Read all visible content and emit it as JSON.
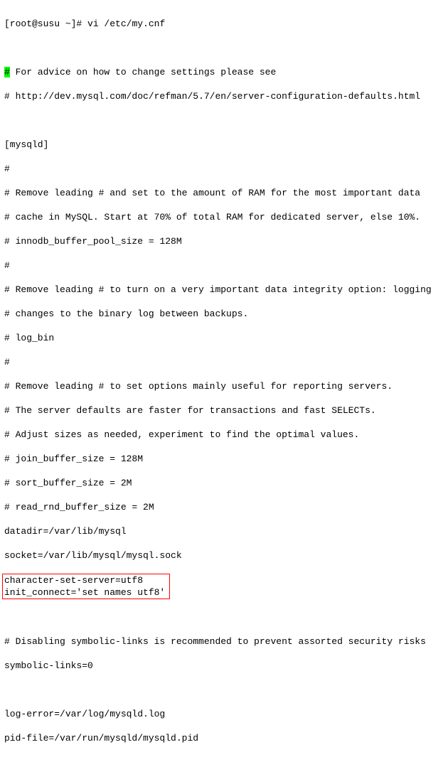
{
  "prompt": "[root@susu ~]# ",
  "command": "vi /etc/my.cnf",
  "lines": {
    "l00_hash": "#",
    "l00_rest": " For advice on how to change settings please see",
    "l01": "# http://dev.mysql.com/doc/refman/5.7/en/server-configuration-defaults.html",
    "l02": "",
    "l03": "[mysqld]",
    "l04": "#",
    "l05": "# Remove leading # and set to the amount of RAM for the most important data",
    "l06": "# cache in MySQL. Start at 70% of total RAM for dedicated server, else 10%.",
    "l07": "# innodb_buffer_pool_size = 128M",
    "l08": "#",
    "l09": "# Remove leading # to turn on a very important data integrity option: logging",
    "l10": "# changes to the binary log between backups.",
    "l11": "# log_bin",
    "l12": "#",
    "l13": "# Remove leading # to set options mainly useful for reporting servers.",
    "l14": "# The server defaults are faster for transactions and fast SELECTs.",
    "l15": "# Adjust sizes as needed, experiment to find the optimal values.",
    "l16": "# join_buffer_size = 128M",
    "l17": "# sort_buffer_size = 2M",
    "l18": "# read_rnd_buffer_size = 2M",
    "l19": "datadir=/var/lib/mysql",
    "l20": "socket=/var/lib/mysql/mysql.sock",
    "l21": "character-set-server=utf8",
    "l22": "init_connect='set names utf8'",
    "l23": "",
    "l24": "# Disabling symbolic-links is recommended to prevent assorted security risks",
    "l25": "symbolic-links=0",
    "l26": "",
    "l27": "log-error=/var/log/mysqld.log",
    "l28": "pid-file=/var/run/mysqld/mysqld.pid"
  }
}
